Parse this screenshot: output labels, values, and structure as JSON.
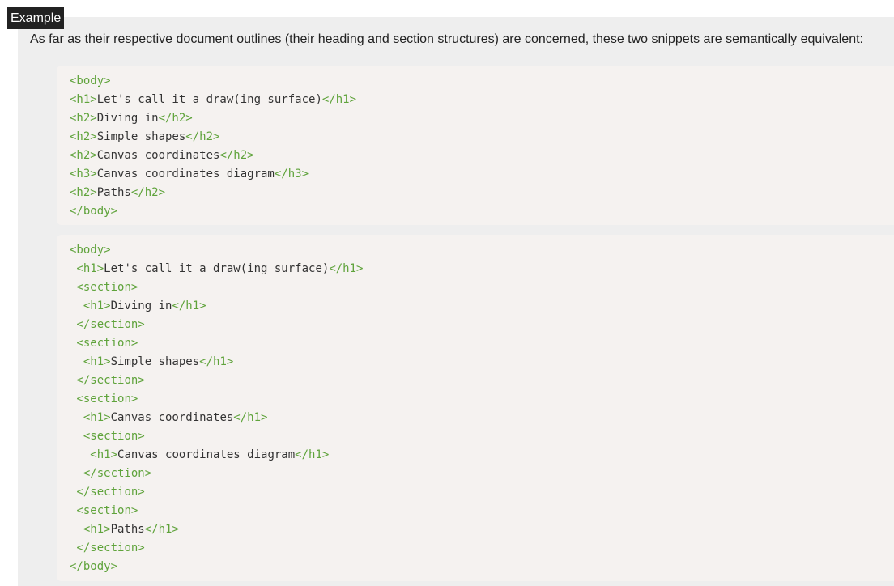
{
  "example_label": "Example",
  "intro_text": "As far as their respective document outlines (their heading and section structures) are concerned, these two snippets are semantically equivalent:",
  "snippets": [
    {
      "lines": [
        {
          "indent": "",
          "open": "<body>",
          "text": "",
          "close": ""
        },
        {
          "indent": "",
          "open": "<h1>",
          "text": "Let's call it a draw(ing surface)",
          "close": "</h1>"
        },
        {
          "indent": "",
          "open": "<h2>",
          "text": "Diving in",
          "close": "</h2>"
        },
        {
          "indent": "",
          "open": "<h2>",
          "text": "Simple shapes",
          "close": "</h2>"
        },
        {
          "indent": "",
          "open": "<h2>",
          "text": "Canvas coordinates",
          "close": "</h2>"
        },
        {
          "indent": "",
          "open": "<h3>",
          "text": "Canvas coordinates diagram",
          "close": "</h3>"
        },
        {
          "indent": "",
          "open": "<h2>",
          "text": "Paths",
          "close": "</h2>"
        },
        {
          "indent": "",
          "open": "</body>",
          "text": "",
          "close": ""
        }
      ]
    },
    {
      "lines": [
        {
          "indent": "",
          "open": "<body>",
          "text": "",
          "close": ""
        },
        {
          "indent": " ",
          "open": "<h1>",
          "text": "Let's call it a draw(ing surface)",
          "close": "</h1>"
        },
        {
          "indent": " ",
          "open": "<section>",
          "text": "",
          "close": ""
        },
        {
          "indent": "  ",
          "open": "<h1>",
          "text": "Diving in",
          "close": "</h1>"
        },
        {
          "indent": " ",
          "open": "</section>",
          "text": "",
          "close": ""
        },
        {
          "indent": " ",
          "open": "<section>",
          "text": "",
          "close": ""
        },
        {
          "indent": "  ",
          "open": "<h1>",
          "text": "Simple shapes",
          "close": "</h1>"
        },
        {
          "indent": " ",
          "open": "</section>",
          "text": "",
          "close": ""
        },
        {
          "indent": " ",
          "open": "<section>",
          "text": "",
          "close": ""
        },
        {
          "indent": "  ",
          "open": "<h1>",
          "text": "Canvas coordinates",
          "close": "</h1>"
        },
        {
          "indent": "  ",
          "open": "<section>",
          "text": "",
          "close": ""
        },
        {
          "indent": "   ",
          "open": "<h1>",
          "text": "Canvas coordinates diagram",
          "close": "</h1>"
        },
        {
          "indent": "  ",
          "open": "</section>",
          "text": "",
          "close": ""
        },
        {
          "indent": " ",
          "open": "</section>",
          "text": "",
          "close": ""
        },
        {
          "indent": " ",
          "open": "<section>",
          "text": "",
          "close": ""
        },
        {
          "indent": "  ",
          "open": "<h1>",
          "text": "Paths",
          "close": "</h1>"
        },
        {
          "indent": " ",
          "open": "</section>",
          "text": "",
          "close": ""
        },
        {
          "indent": "",
          "open": "</body>",
          "text": "",
          "close": ""
        }
      ]
    }
  ],
  "colors": {
    "example_bg": "#eeeeee",
    "label_bg": "#222222",
    "code_bg": "#f5f2f0",
    "tag_color": "#5fa33b",
    "text_color": "#333333"
  }
}
